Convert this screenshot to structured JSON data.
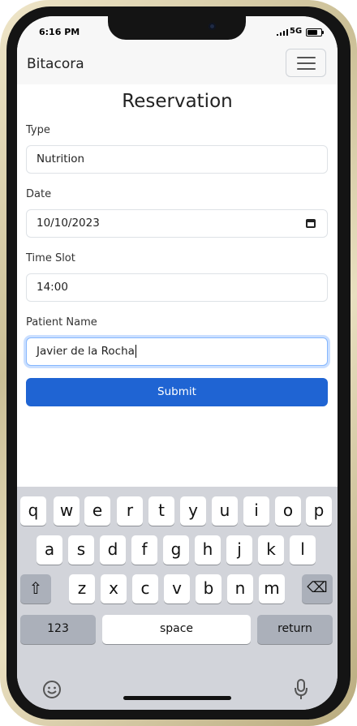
{
  "status_bar": {
    "time": "6:16 PM",
    "network": "5G"
  },
  "navbar": {
    "brand": "Bitacora"
  },
  "page": {
    "title": "Reservation"
  },
  "form": {
    "type_label": "Type",
    "type_value": "Nutrition",
    "date_label": "Date",
    "date_value": "10/10/2023",
    "time_label": "Time Slot",
    "time_value": "14:00",
    "patient_label": "Patient Name",
    "patient_value": "Javier de la Rocha",
    "submit_label": "Submit"
  },
  "keyboard": {
    "row1": [
      "q",
      "w",
      "e",
      "r",
      "t",
      "y",
      "u",
      "i",
      "o",
      "p"
    ],
    "row2": [
      "a",
      "s",
      "d",
      "f",
      "g",
      "h",
      "j",
      "k",
      "l"
    ],
    "row3": [
      "z",
      "x",
      "c",
      "v",
      "b",
      "n",
      "m"
    ],
    "shift": "⇧",
    "backspace": "⌫",
    "numbers": "123",
    "space": "space",
    "return": "return",
    "emoji": "☺",
    "mic": "mic-icon"
  },
  "colors": {
    "accent": "#1f64d3",
    "focus_ring": "#86b7fe",
    "keyboard_bg": "#d2d4da"
  }
}
